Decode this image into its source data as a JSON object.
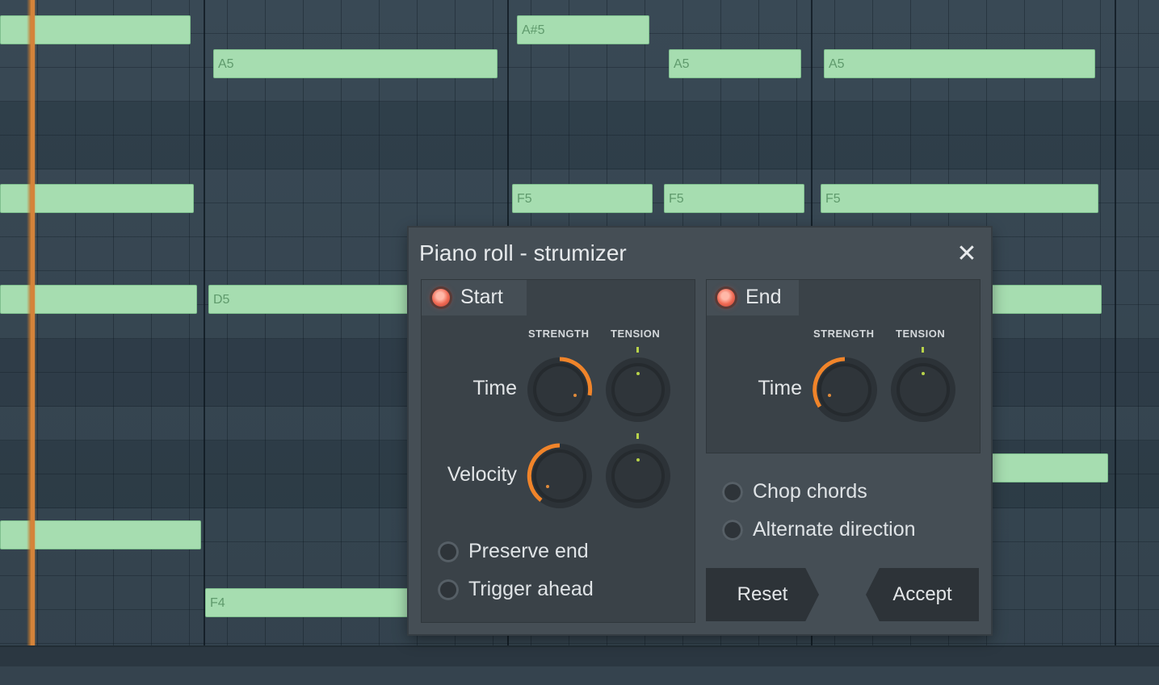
{
  "dialog": {
    "title": "Piano roll - strumizer",
    "start_label": "Start",
    "end_label": "End",
    "strength_header": "STRENGTH",
    "tension_header": "TENSION",
    "time_label": "Time",
    "velocity_label": "Velocity",
    "options_left": [
      "Preserve end",
      "Trigger ahead"
    ],
    "options_right": [
      "Chop chords",
      "Alternate direction"
    ],
    "reset_label": "Reset",
    "accept_label": "Accept"
  },
  "notes": [
    {
      "label": ""
    },
    {
      "label": "A5"
    },
    {
      "label": "A#5"
    },
    {
      "label": "A5"
    },
    {
      "label": "A5"
    },
    {
      "label": ""
    },
    {
      "label": "F5"
    },
    {
      "label": "F5"
    },
    {
      "label": "F5"
    },
    {
      "label": ""
    },
    {
      "label": "D5"
    },
    {
      "label": ""
    },
    {
      "label": ""
    },
    {
      "label": ""
    },
    {
      "label": "F4"
    }
  ],
  "colors": {
    "note_fill": "#a6ddb0",
    "grid_bg": "#34434f",
    "dialog_bg": "#454e55",
    "knob_accent": "#f0842a",
    "led": "#f06b55",
    "playhead": "#d4833a"
  },
  "icons": {
    "close": "close-icon",
    "led": "led-indicator-icon",
    "knob": "knob-icon",
    "radio": "radio-icon"
  }
}
